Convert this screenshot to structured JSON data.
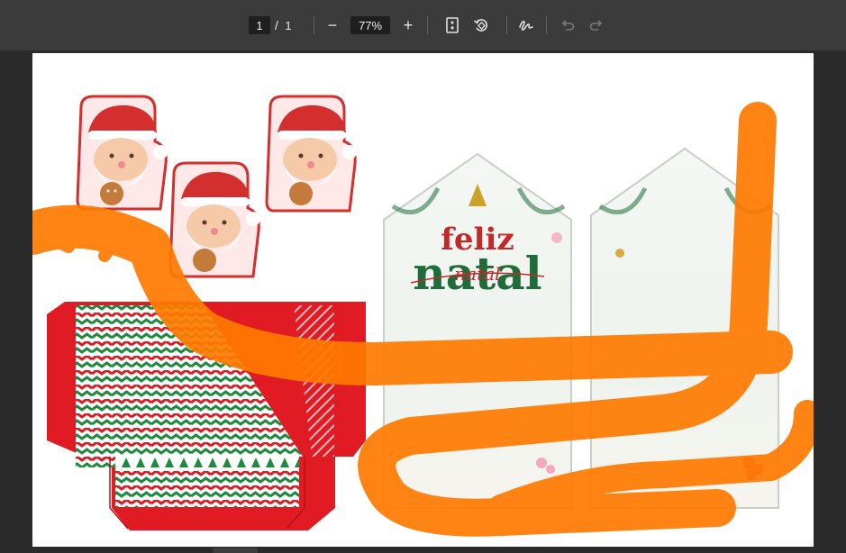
{
  "toolbar": {
    "current_page": "1",
    "page_separator": "/",
    "total_pages": "1",
    "zoom_out_symbol": "−",
    "zoom_level": "77%",
    "zoom_in_symbol": "+"
  },
  "document": {
    "tag_text_top": "feliz",
    "tag_text_bottom": "natal",
    "tag_text_script": "natal"
  },
  "colors": {
    "toolbar_bg": "#3b3b3b",
    "viewer_bg": "#2a2a2a",
    "santa_red": "#d32f2f",
    "box_red": "#e01b24",
    "box_green": "#1e8a3e",
    "scribble_orange": "#ff7a00",
    "tag_red": "#c62828",
    "tag_green": "#1f6b3a"
  }
}
